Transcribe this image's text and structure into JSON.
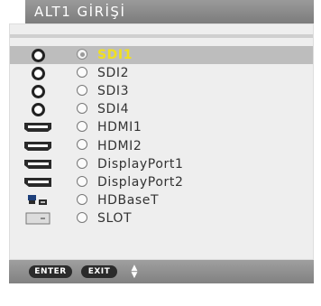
{
  "title": "ALT1 GİRİŞİ",
  "inputs": [
    {
      "label": "SDI1",
      "icon": "sdi-connector-icon",
      "selected": true
    },
    {
      "label": "SDI2",
      "icon": "sdi-connector-icon",
      "selected": false
    },
    {
      "label": "SDI3",
      "icon": "sdi-connector-icon",
      "selected": false
    },
    {
      "label": "SDI4",
      "icon": "sdi-connector-icon",
      "selected": false
    },
    {
      "label": "HDMI1",
      "icon": "hdmi-connector-icon",
      "selected": false
    },
    {
      "label": "HDMI2",
      "icon": "hdmi-connector-icon",
      "selected": false
    },
    {
      "label": "DisplayPort1",
      "icon": "displayport-connector-icon",
      "selected": false
    },
    {
      "label": "DisplayPort2",
      "icon": "displayport-connector-icon",
      "selected": false
    },
    {
      "label": "HDBaseT",
      "icon": "hdbaset-connector-icon",
      "selected": false
    },
    {
      "label": "SLOT",
      "icon": "slot-icon",
      "selected": false
    }
  ],
  "footer": {
    "enter_label": "ENTER",
    "exit_label": "EXIT",
    "updown_up": "▲",
    "updown_down": "▼"
  },
  "colors": {
    "selected_text": "#f0e020",
    "header_bg": "#8c8c8c",
    "panel_bg": "#eeeeee",
    "selected_row_bg": "#bdbdbd"
  }
}
